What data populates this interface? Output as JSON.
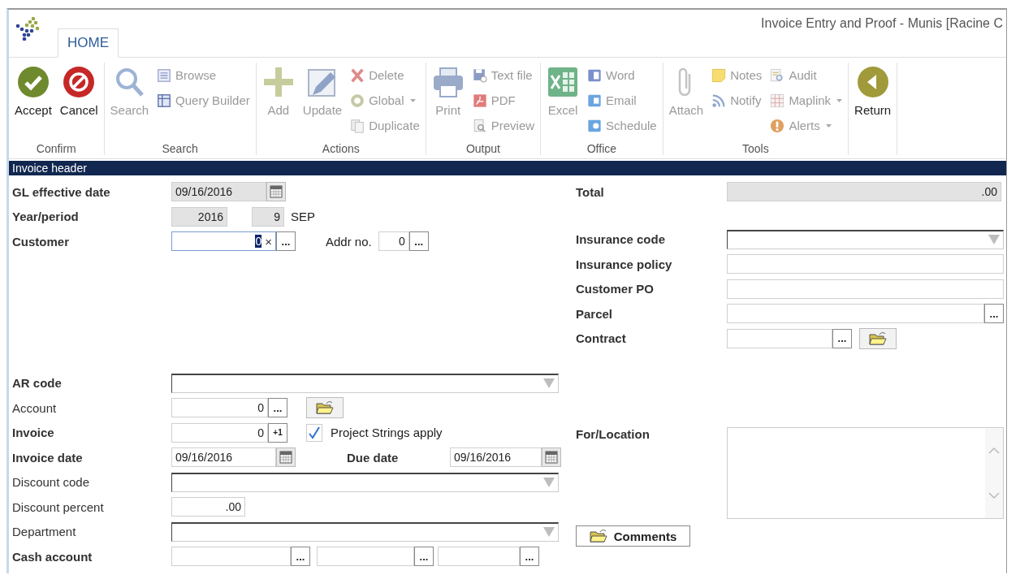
{
  "window": {
    "title": "Invoice Entry and Proof - Munis [Racine C"
  },
  "ribbon": {
    "tabs": [
      {
        "label": "HOME",
        "selected": true
      }
    ],
    "groups": [
      {
        "label": "Confirm",
        "columns": [
          {
            "kind": "large",
            "label": "Accept",
            "disabled": false
          },
          {
            "kind": "large",
            "label": "Cancel",
            "disabled": false
          }
        ]
      },
      {
        "label": "Search",
        "columns": [
          {
            "kind": "large",
            "label": "Search",
            "disabled": true
          },
          {
            "kind": "stack",
            "items": [
              {
                "label": "Browse",
                "disabled": true,
                "dropdown": false
              },
              {
                "label": "Query Builder",
                "disabled": true,
                "dropdown": false
              }
            ]
          }
        ]
      },
      {
        "label": "Actions",
        "columns": [
          {
            "kind": "large",
            "label": "Add",
            "disabled": true
          },
          {
            "kind": "large",
            "label": "Update",
            "disabled": true
          },
          {
            "kind": "stack",
            "items": [
              {
                "label": "Delete",
                "disabled": true,
                "dropdown": false
              },
              {
                "label": "Global",
                "disabled": true,
                "dropdown": true
              },
              {
                "label": "Duplicate",
                "disabled": true,
                "dropdown": false
              }
            ]
          }
        ]
      },
      {
        "label": "Output",
        "columns": [
          {
            "kind": "large",
            "label": "Print",
            "disabled": true
          },
          {
            "kind": "stack",
            "items": [
              {
                "label": "Text file",
                "disabled": true,
                "dropdown": false
              },
              {
                "label": "PDF",
                "disabled": true,
                "dropdown": false
              },
              {
                "label": "Preview",
                "disabled": true,
                "dropdown": false
              }
            ]
          }
        ]
      },
      {
        "label": "Office",
        "columns": [
          {
            "kind": "large",
            "label": "Excel",
            "disabled": true
          },
          {
            "kind": "stack",
            "items": [
              {
                "label": "Word",
                "disabled": true,
                "dropdown": false
              },
              {
                "label": "Email",
                "disabled": true,
                "dropdown": false
              },
              {
                "label": "Schedule",
                "disabled": true,
                "dropdown": false
              }
            ]
          }
        ]
      },
      {
        "label": "Tools",
        "columns": [
          {
            "kind": "large",
            "label": "Attach",
            "disabled": true
          },
          {
            "kind": "stack",
            "items": [
              {
                "label": "Notes",
                "disabled": true,
                "dropdown": false
              },
              {
                "label": "Notify",
                "disabled": true,
                "dropdown": false
              }
            ]
          },
          {
            "kind": "stack",
            "items": [
              {
                "label": "Audit",
                "disabled": true,
                "dropdown": false
              },
              {
                "label": "Maplink",
                "disabled": true,
                "dropdown": true
              },
              {
                "label": "Alerts",
                "disabled": true,
                "dropdown": true
              }
            ]
          }
        ]
      },
      {
        "columns": [
          {
            "kind": "large",
            "label": "Return",
            "disabled": false
          }
        ]
      }
    ]
  },
  "panel": {
    "title": "Invoice header"
  },
  "form": {
    "left": [
      [
        {
          "kind": "date",
          "label": "GL effective date",
          "required": true,
          "value": "09/16/2016",
          "disabled": true,
          "focused": false
        },
        {
          "kind": "year_period",
          "label": "Year/period",
          "required": true,
          "year": "2016",
          "period": "9",
          "month": "SEP",
          "disabled": true,
          "focused": false
        },
        {
          "kind": "customer",
          "label": "Customer",
          "required": true,
          "value": "0",
          "clear": "×",
          "button": "...",
          "addr_label": "Addr no.",
          "addr_value": "0",
          "addr_button": "...",
          "disabled": false,
          "focused": true
        }
      ],
      [
        {
          "kind": "select",
          "label": "AR code",
          "required": true,
          "disabled": false,
          "focused": false
        },
        {
          "kind": "lookup_folder",
          "label": "Account",
          "required": false,
          "value": "0",
          "button": "...",
          "disabled": false,
          "focused": false
        },
        {
          "kind": "invoice",
          "label": "Invoice",
          "required": true,
          "value": "0",
          "button": "+1",
          "checkbox": {
            "label": "Project Strings apply",
            "checked": true
          },
          "disabled": false,
          "focused": false
        },
        {
          "kind": "date_pair",
          "label": "Invoice date",
          "required": true,
          "value": "09/16/2016",
          "second_label": "Due date",
          "second_value": "09/16/2016",
          "disabled": false,
          "focused": false
        },
        {
          "kind": "select",
          "label": "Discount code",
          "required": false,
          "disabled": false,
          "focused": false
        },
        {
          "kind": "number",
          "label": "Discount percent",
          "required": false,
          "value": ".00",
          "disabled": false,
          "focused": false
        },
        {
          "kind": "select",
          "label": "Department",
          "required": false,
          "disabled": false,
          "focused": false
        },
        {
          "kind": "triple_lookup",
          "label": "Cash account",
          "required": true,
          "buttons": [
            "...",
            "...",
            "..."
          ],
          "disabled": false,
          "focused": false
        }
      ]
    ],
    "right": [
      [
        {
          "kind": "number",
          "label": "Total",
          "required": true,
          "value": ".00",
          "disabled": true,
          "focused": false
        }
      ],
      [
        {
          "kind": "select",
          "label": "Insurance code",
          "required": true,
          "disabled": false,
          "focused": false
        },
        {
          "kind": "text",
          "label": "Insurance policy",
          "required": true,
          "disabled": false,
          "focused": false
        },
        {
          "kind": "text",
          "label": "Customer PO",
          "required": true,
          "disabled": false,
          "focused": false
        },
        {
          "kind": "lookup",
          "label": "Parcel",
          "required": true,
          "button": "...",
          "disabled": false,
          "focused": false
        },
        {
          "kind": "lookup_folder",
          "label": "Contract",
          "required": true,
          "button": "...",
          "disabled": false,
          "focused": false
        }
      ],
      [
        {
          "kind": "textarea",
          "label": "For/Location",
          "required": true,
          "disabled": false,
          "focused": false
        }
      ],
      [
        {
          "kind": "button",
          "label": "Comments",
          "disabled": false,
          "focused": false
        }
      ]
    ]
  }
}
